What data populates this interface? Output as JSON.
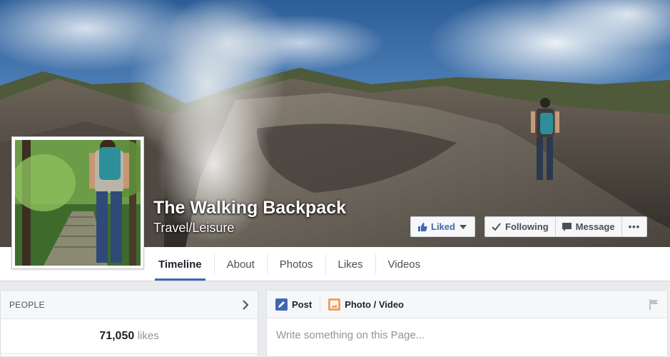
{
  "page": {
    "name": "The Walking Backpack",
    "category": "Travel/Leisure"
  },
  "actions": {
    "liked_label": "Liked",
    "following_label": "Following",
    "message_label": "Message",
    "more_label": "•••"
  },
  "tabs": [
    {
      "label": "Timeline",
      "active": true
    },
    {
      "label": "About",
      "active": false
    },
    {
      "label": "Photos",
      "active": false
    },
    {
      "label": "Likes",
      "active": false
    },
    {
      "label": "Videos",
      "active": false
    }
  ],
  "people": {
    "title": "PEOPLE",
    "likes_count": "71,050",
    "likes_label": "likes"
  },
  "composer": {
    "post_label": "Post",
    "photo_video_label": "Photo / Video",
    "placeholder": "Write something on this Page..."
  },
  "colors": {
    "brand_blue": "#4267b2",
    "page_bg": "#e9ebee"
  },
  "icons": [
    "thumbs-up-icon",
    "caret-down-icon",
    "check-icon",
    "message-icon",
    "more-icon",
    "chevron-right-icon",
    "pencil-icon",
    "photo-icon",
    "flag-icon"
  ]
}
